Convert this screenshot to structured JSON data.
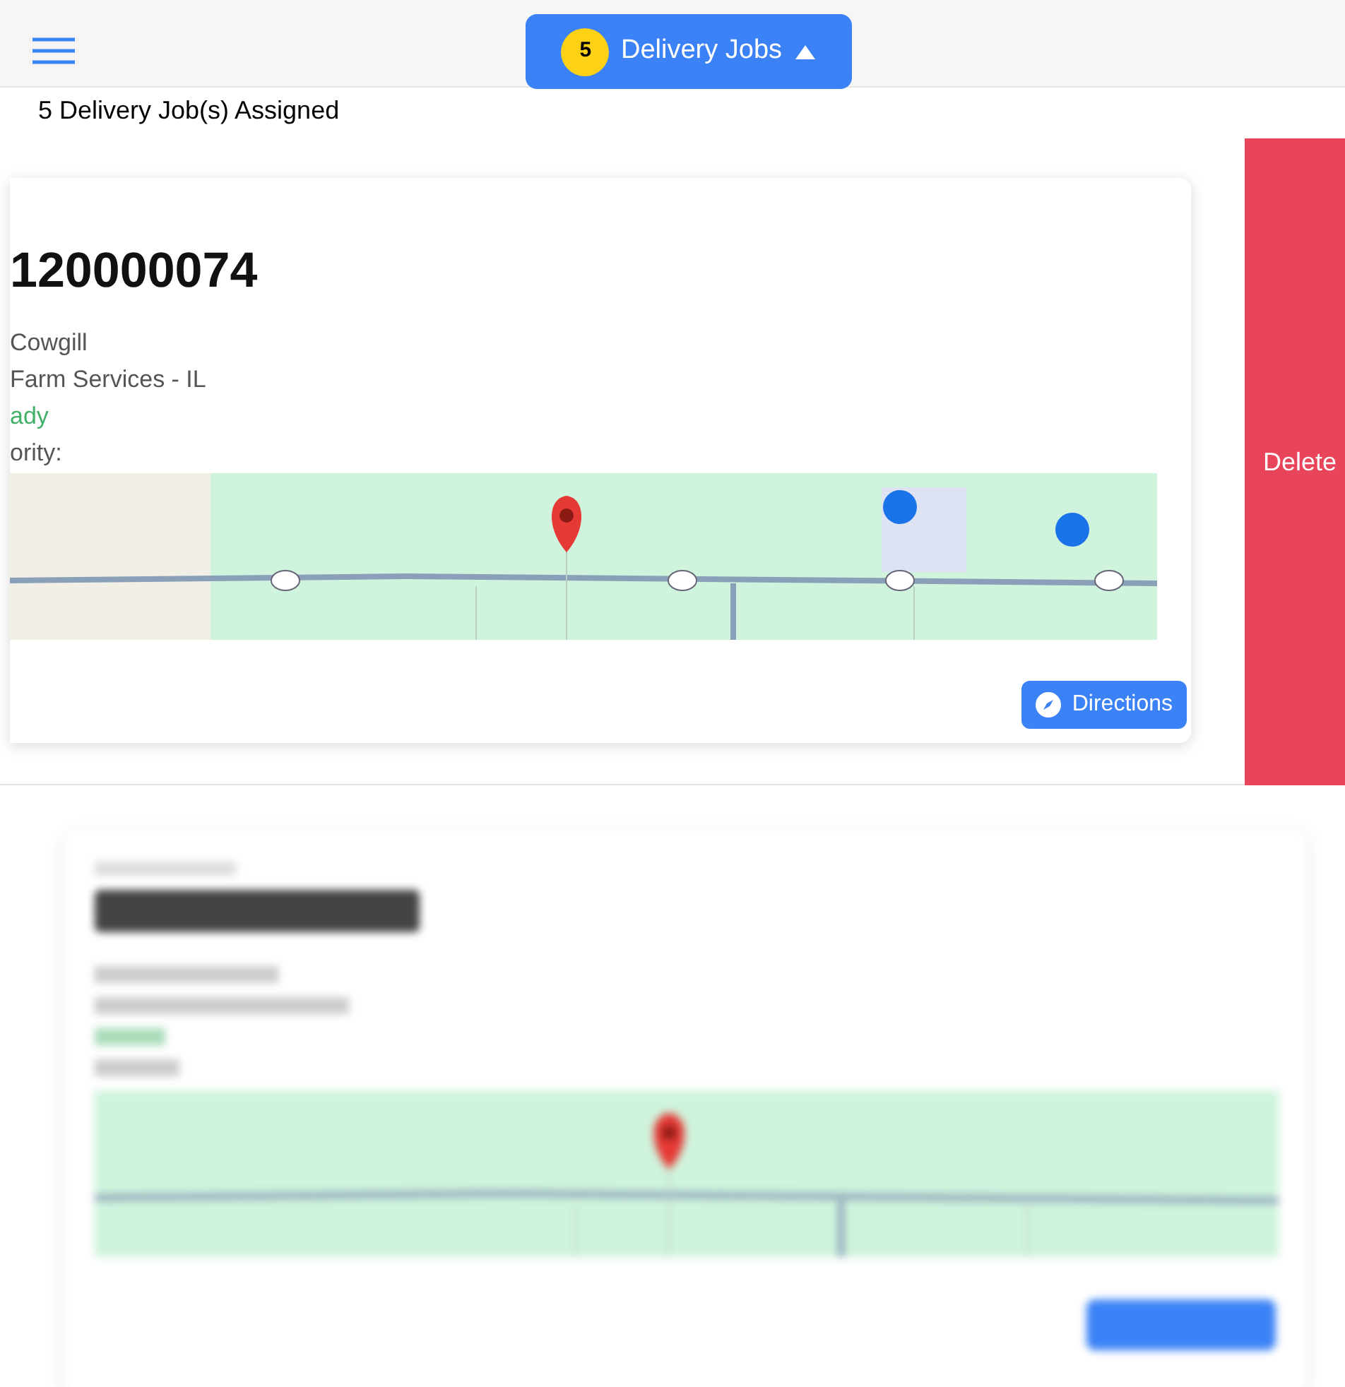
{
  "header": {
    "jobs_button": {
      "count": "5",
      "label": "Delivery Jobs",
      "expanded": true
    }
  },
  "summary": "5 Delivery Job(s) Assigned",
  "job_card": {
    "number": "120000074",
    "customer": "Cowgill",
    "branch": "Farm Services - IL",
    "status": "ady",
    "priority_label": "ority:",
    "directions_button": "Directions"
  },
  "swipe_action": {
    "label": "Delete"
  }
}
